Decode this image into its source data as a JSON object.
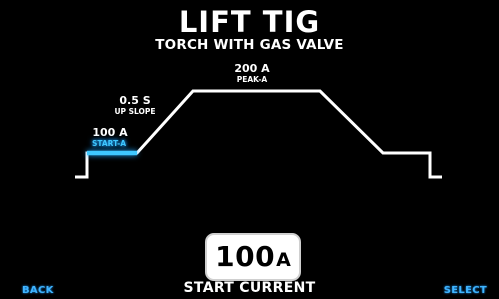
{
  "screen": {
    "title": "LIFT TIG",
    "subtitle": "TORCH WITH GAS VALVE"
  },
  "graph": {
    "peak_value": "200 A",
    "peak_name": "PEAK-A",
    "upslope_value": "0.5 S",
    "upslope_name": "UP SLOPE",
    "start_value": "100 A",
    "start_name": "START-A",
    "selected_segment": "START-A"
  },
  "parameter": {
    "value": "100",
    "unit": "A",
    "name": "START CURRENT"
  },
  "softkeys": {
    "back": "BACK",
    "select": "SELECT"
  },
  "colors": {
    "background": "#000000",
    "foreground": "#ffffff",
    "highlight": "#3fc8ff",
    "softkey": "#3fb4ff"
  }
}
